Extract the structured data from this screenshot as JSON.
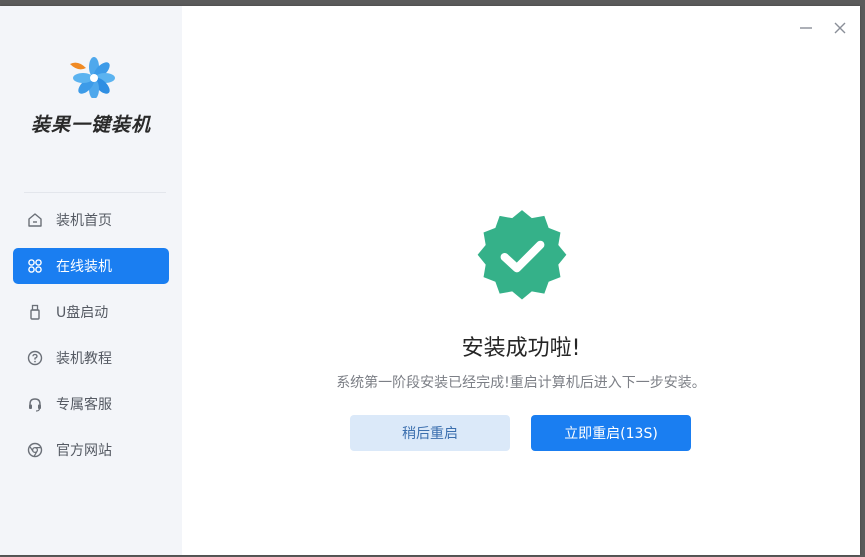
{
  "app": {
    "brand": "装果一键装机"
  },
  "sidebar": {
    "items": [
      {
        "label": "装机首页",
        "icon": "home-icon",
        "active": false
      },
      {
        "label": "在线装机",
        "icon": "online-install-icon",
        "active": true
      },
      {
        "label": "U盘启动",
        "icon": "usb-icon",
        "active": false
      },
      {
        "label": "装机教程",
        "icon": "help-icon",
        "active": false
      },
      {
        "label": "专属客服",
        "icon": "headset-icon",
        "active": false
      },
      {
        "label": "官方网站",
        "icon": "browser-icon",
        "active": false
      }
    ]
  },
  "window": {
    "minimize_glyph": "–",
    "close_glyph": "✕"
  },
  "result": {
    "title": "安装成功啦!",
    "message": "系统第一阶段安装已经完成!重启计算机后进入下一步安装。",
    "icon": "check-badge-icon"
  },
  "actions": {
    "later_label": "稍后重启",
    "now_label": "立即重启(13S)"
  },
  "colors": {
    "accent": "#1a7ef1",
    "success": "#35b189",
    "sidebar_bg": "#f3f5f9"
  }
}
